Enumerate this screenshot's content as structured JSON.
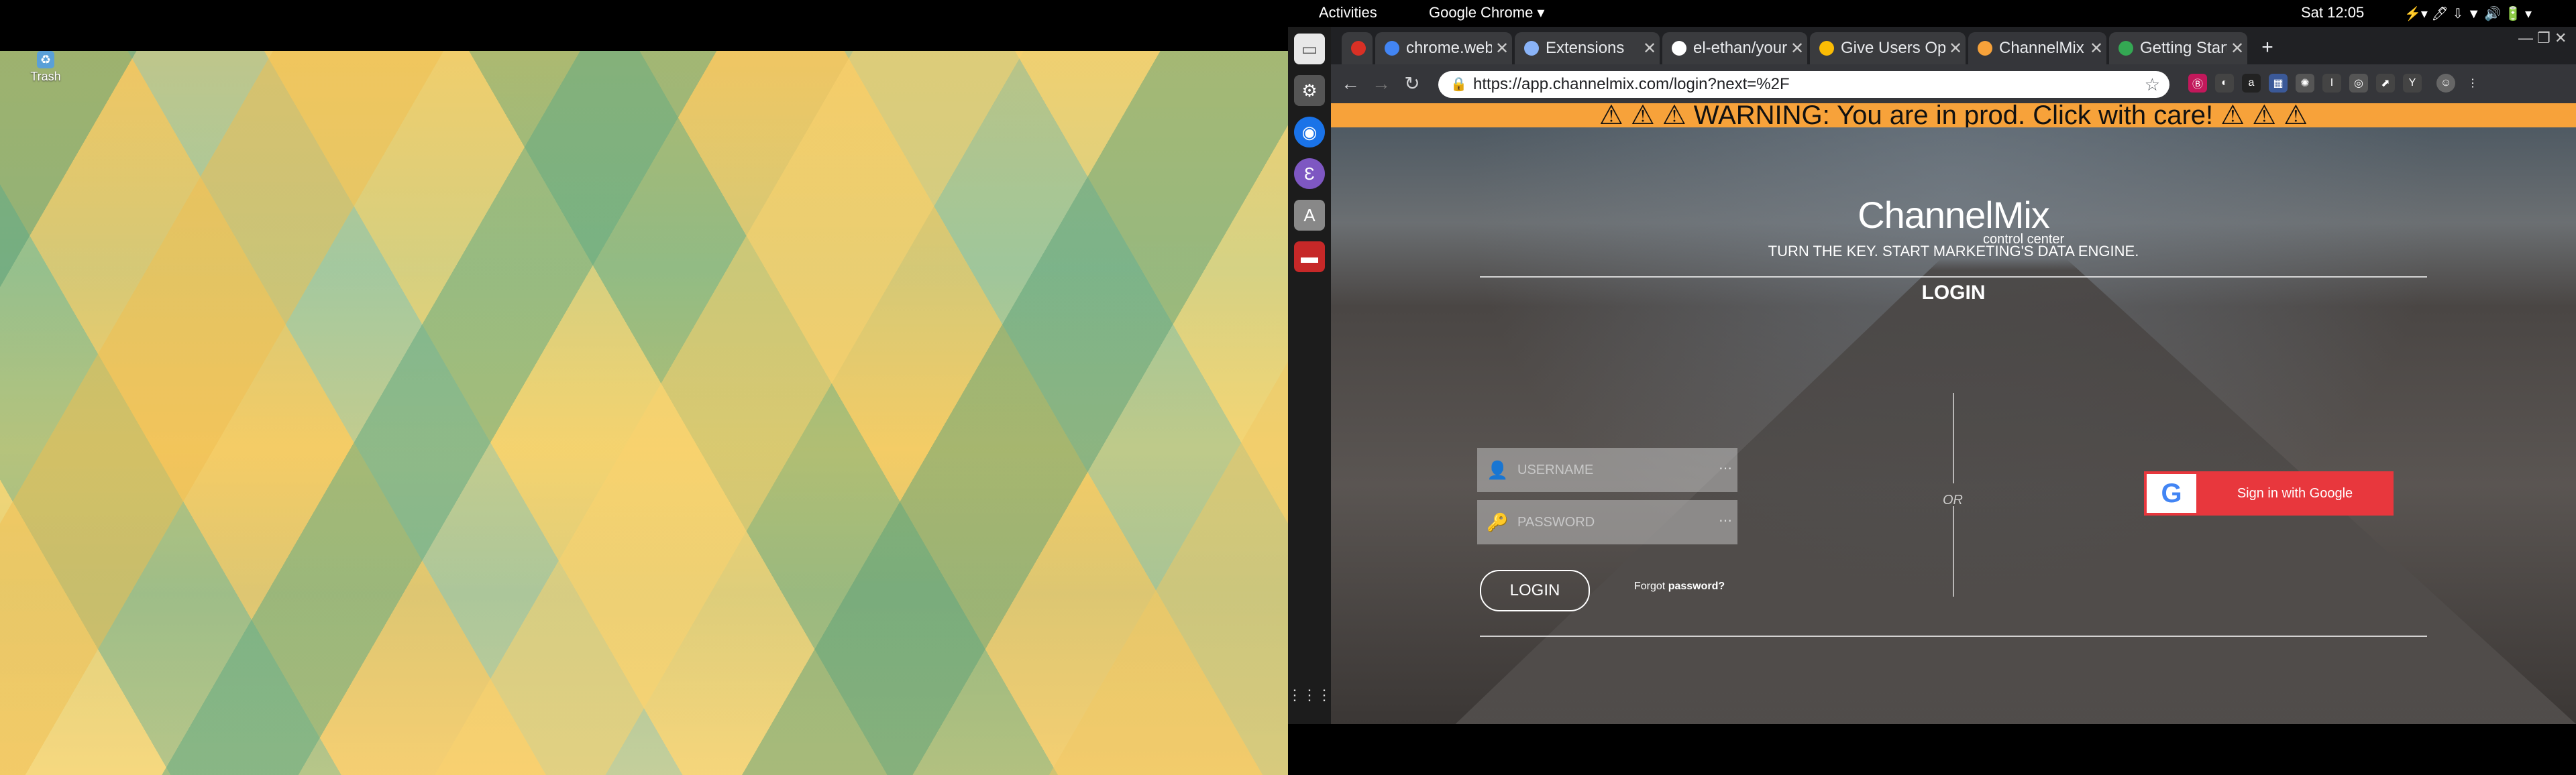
{
  "desktop": {
    "trash_label": "Trash"
  },
  "topbar": {
    "activities": "Activities",
    "app_menu": "Google Chrome ▾",
    "clock": "Sat 12:05",
    "tray": "⚡▾  🖊  ⇩  ▼  🔊  🔋 ▾"
  },
  "dock": {
    "items": [
      {
        "name": "files",
        "icon": "📁"
      },
      {
        "name": "settings",
        "icon": "⚙"
      },
      {
        "name": "chrome",
        "icon": "◉"
      },
      {
        "name": "emacs",
        "icon": "Ɛ"
      },
      {
        "name": "software",
        "icon": "A"
      },
      {
        "name": "terminal",
        "icon": "▬"
      }
    ],
    "apps_grid": "⋮⋮⋮"
  },
  "tabs": [
    {
      "title": "",
      "favicon_color": "#d93025"
    },
    {
      "title": "chrome.webt",
      "favicon_color": "#4285f4"
    },
    {
      "title": "Extensions",
      "favicon_color": "#8ab4f8"
    },
    {
      "title": "el-ethan/your",
      "favicon_color": "#ffffff"
    },
    {
      "title": "Give Users Op",
      "favicon_color": "#fbbc04"
    },
    {
      "title": "ChannelMix C",
      "favicon_color": "#f7a23a"
    },
    {
      "title": "Getting Start",
      "favicon_color": "#34a853"
    }
  ],
  "toolbar": {
    "url": "https://app.channelmix.com/login?next=%2F",
    "extensions": [
      "Ⓑ",
      "◐",
      "a",
      "▦",
      "✺",
      "I",
      "◎",
      "⬈",
      "Y",
      "☺",
      "⋮"
    ]
  },
  "warning_banner": "⚠ ⚠ ⚠ WARNING: You are in prod. Click with care! ⚠ ⚠ ⚠",
  "login_page": {
    "brand": "ChannelMix",
    "brand_sub": "control center",
    "tagline": "TURN THE KEY. START MARKETING'S DATA ENGINE.",
    "title": "LOGIN",
    "username_placeholder": "USERNAME",
    "password_placeholder": "PASSWORD",
    "login_button": "LOGIN",
    "forgot_prefix": "Forgot",
    "forgot_link": "password?",
    "or_label": "OR",
    "google_button": "Sign in with Google"
  }
}
